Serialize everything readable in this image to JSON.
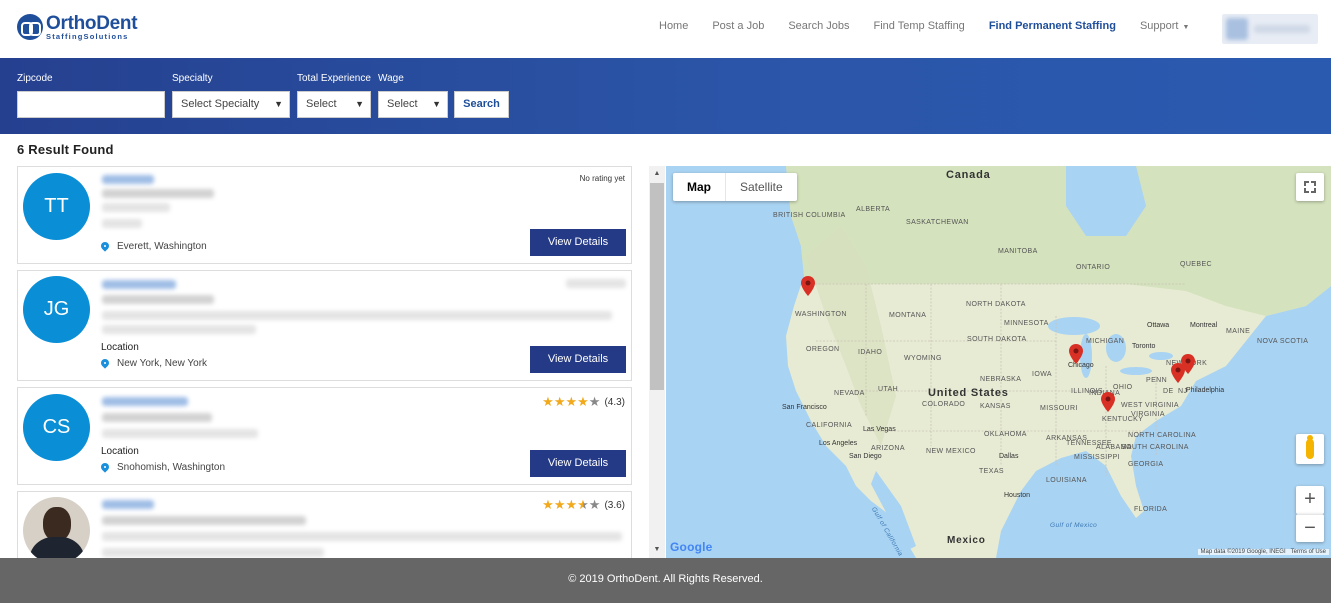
{
  "brand": {
    "name": "OrthoDent",
    "sub": "StaffingSolutions"
  },
  "nav": {
    "items": [
      {
        "label": "Home"
      },
      {
        "label": "Post a Job"
      },
      {
        "label": "Search Jobs"
      },
      {
        "label": "Find Temp Staffing"
      },
      {
        "label": "Find Permanent Staffing",
        "active": true
      },
      {
        "label": "Support"
      }
    ]
  },
  "search": {
    "zipcode_label": "Zipcode",
    "zipcode_value": "",
    "specialty_label": "Specialty",
    "specialty_value": "Select Specialty",
    "experience_label": "Total Experience",
    "experience_value": "Select",
    "wage_label": "Wage",
    "wage_value": "Select",
    "search_button": "Search"
  },
  "results": {
    "count_text": "6 Result Found",
    "cards": [
      {
        "initials": "TT",
        "location_label": "",
        "location": "Everett, Washington",
        "rating_text": "No rating yet",
        "button": "View Details"
      },
      {
        "initials": "JG",
        "location_label": "Location",
        "location": "New York, New York",
        "button": "View Details"
      },
      {
        "initials": "CS",
        "location_label": "Location",
        "location": "Snohomish, Washington",
        "rating": 4.3,
        "rating_text": "(4.3)",
        "button": "View Details"
      },
      {
        "initials": "",
        "rating": 3.6,
        "rating_text": "(3.6)"
      }
    ]
  },
  "map": {
    "type_map": "Map",
    "type_satellite": "Satellite",
    "google": "Google",
    "attribution": "Map data ©2019 Google, INEGI",
    "terms": "Terms of Use",
    "labels": {
      "canada": "Canada",
      "united_states": "United States",
      "mexico": "Mexico",
      "british_columbia": "BRITISH COLUMBIA",
      "alberta": "ALBERTA",
      "saskatchewan": "SASKATCHEWAN",
      "manitoba": "MANITOBA",
      "ontario": "ONTARIO",
      "quebec": "QUEBEC",
      "washington": "WASHINGTON",
      "montana": "MONTANA",
      "north_dakota": "NORTH DAKOTA",
      "minnesota": "MINNESOTA",
      "oregon": "OREGON",
      "idaho": "IDAHO",
      "wyoming": "WYOMING",
      "south_dakota": "SOUTH DAKOTA",
      "nevada": "NEVADA",
      "utah": "UTAH",
      "colorado": "COLORADO",
      "kansas": "KANSAS",
      "missouri": "MISSOURI",
      "california": "CALIFORNIA",
      "arizona": "ARIZONA",
      "new_mexico": "NEW MEXICO",
      "oklahoma": "OKLAHOMA",
      "texas": "TEXAS",
      "iowa": "IOWA",
      "nebraska": "NEBRASKA",
      "illinois": "ILLINOIS",
      "indiana": "INDIANA",
      "ohio": "OHIO",
      "michigan": "MICHIGAN",
      "kentucky": "KENTUCKY",
      "tennessee": "TENNESSEE",
      "virginia": "VIRGINIA",
      "west_virginia": "WEST VIRGINIA",
      "north_carolina": "NORTH CAROLINA",
      "south_carolina": "SOUTH CAROLINA",
      "georgia": "GEORGIA",
      "alabama": "ALABAMA",
      "mississippi": "MISSISSIPPI",
      "louisiana": "LOUISIANA",
      "arkansas": "ARKANSAS",
      "florida": "FLORIDA",
      "pennsylvania": "PENN",
      "new_jersey": "NJ",
      "new_york_state": "NEW YORK",
      "maine": "MAINE",
      "de": "DE",
      "nova_scotia": "NOVA SCOTIA",
      "ottawa": "Ottawa",
      "montreal": "Montreal",
      "toronto": "Toronto",
      "chicago": "Chicago",
      "philadelphia": "Philadelphia",
      "san_francisco": "San Francisco",
      "los_angeles": "Los Angeles",
      "las_vegas": "Las Vegas",
      "san_diego": "San Diego",
      "dallas": "Dallas",
      "houston": "Houston",
      "gulf_of_california": "Gulf of California",
      "gulf_of_mexico": "Gulf of Mexico"
    }
  },
  "footer": {
    "text": "© 2019 OrthoDent. All Rights Reserved."
  },
  "colors": {
    "brand": "#1f4e9a",
    "button": "#243a86",
    "avatar": "#0a8fd6",
    "star": "#f2a91c",
    "pin": "#d93025"
  }
}
